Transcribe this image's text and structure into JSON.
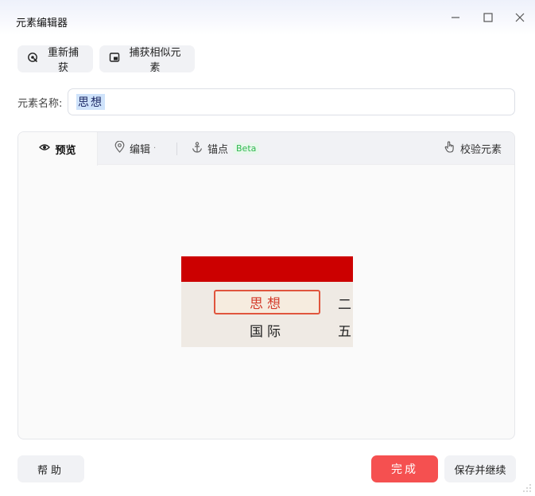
{
  "window": {
    "title": "元素编辑器",
    "controls": [
      "minimize-icon",
      "maximize-icon",
      "close-icon"
    ]
  },
  "toolbar": {
    "recapture_label": "重新捕获",
    "capture_similar_label": "捕获相似元素"
  },
  "element_name": {
    "label": "元素名称:",
    "value": "思想"
  },
  "tabs": [
    {
      "label": "预览",
      "icon": "eye-icon",
      "active": true
    },
    {
      "label": "编辑",
      "icon": "location-pin-icon",
      "has_dropdown": true
    },
    {
      "label": "锚点",
      "icon": "anchor-icon",
      "badge": "Beta"
    }
  ],
  "validate": {
    "label": "校验元素",
    "icon": "hand-pointer-icon"
  },
  "preview": {
    "selected_text": "思想",
    "texts": [
      "国际",
      "二",
      "五"
    ]
  },
  "footer": {
    "help_label": "帮助",
    "done_label": "完成",
    "save_continue_label": "保存并继续"
  },
  "colors": {
    "primary": "#f55050",
    "beta_green": "#2fb94f",
    "preview_band": "#cc0000",
    "selection_border": "#e0553d"
  }
}
